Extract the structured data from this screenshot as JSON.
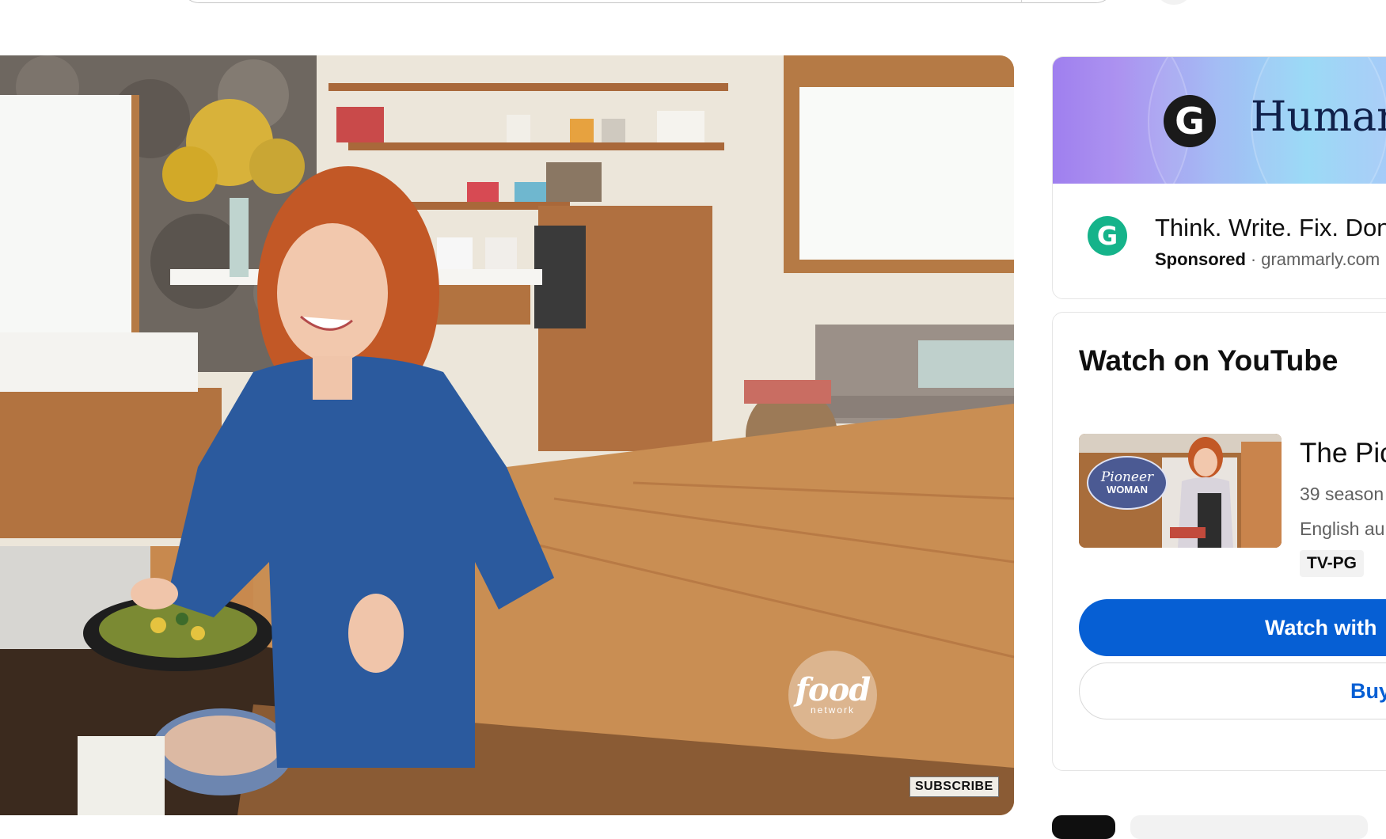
{
  "player": {
    "watermark_main": "food",
    "watermark_sub": "network",
    "subscribe_label": "SUBSCRIBE"
  },
  "ad": {
    "banner_text": "Human",
    "headline": "Think. Write. Fix. Don",
    "sponsored_label": "Sponsored",
    "separator": "·",
    "domain": "grammarly.com",
    "logo_letter": "G"
  },
  "watch": {
    "title": "Watch on YouTube",
    "show_title": "The Pic",
    "seasons": "39 season",
    "audio": "English au",
    "rating": "TV-PG",
    "thumb_logo_line1": "Pioneer",
    "thumb_logo_line2": "WOMAN",
    "primary_button": "Watch with",
    "secondary_button": "Buy"
  },
  "colors": {
    "accent": "#065fd4",
    "grammarly_green": "#15b38a"
  }
}
